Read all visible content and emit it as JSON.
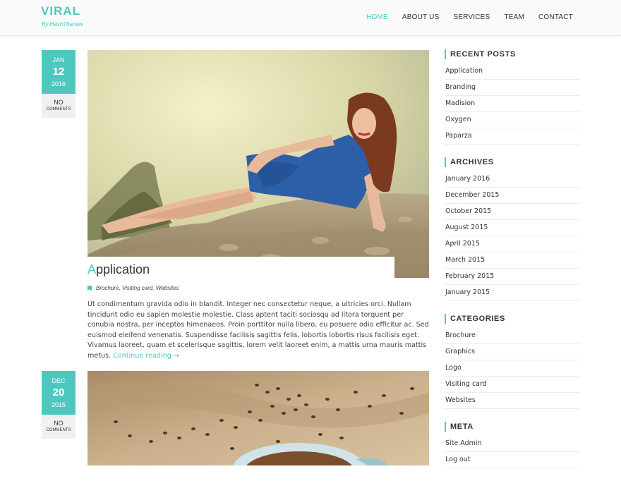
{
  "site": {
    "title": "VIRAL",
    "tagline": "By HashThemes"
  },
  "nav": {
    "items": [
      {
        "label": "HOME",
        "active": true
      },
      {
        "label": "ABOUT US"
      },
      {
        "label": "SERVICES"
      },
      {
        "label": "TEAM"
      },
      {
        "label": "CONTACT"
      }
    ]
  },
  "posts": [
    {
      "month": "JAN",
      "day": "12",
      "year": "2016",
      "comments_no": "NO",
      "comments_label": "COMMENTS",
      "title_first": "A",
      "title_rest": "pplication",
      "meta": "Brochure, Visiting card, Websites",
      "excerpt": "Ut condimentum gravida odio in blandit. Integer nec consectetur neque, a ultricies orci. Nullam tincidunt odio eu sapien molestie molestie. Class aptent taciti sociosqu ad litora torquent per conubia nostra, per inceptos himenaeos. Proin porttitor nulla libero, eu posuere odio efficitur ac. Sed euismod eleifend venenatis. Suspendisse facilisis sagittis felis, lobortis lobortis risus facilisis eget. Vivamus laoreet, quam et scelerisque sagittis, lorem velit laoreet enim, a mattis urna mauris mattis metus.",
      "read_more": "Continue reading →"
    },
    {
      "month": "DEC",
      "day": "20",
      "year": "2015",
      "comments_no": "NO",
      "comments_label": "COMMENTS"
    }
  ],
  "sidebar": {
    "recent_posts": {
      "title": "RECENT POSTS",
      "items": [
        "Application",
        "Branding",
        "Madision",
        "Oxygen",
        "Paparza"
      ]
    },
    "archives": {
      "title": "ARCHIVES",
      "items": [
        "January 2016",
        "December 2015",
        "October 2015",
        "August 2015",
        "April 2015",
        "March 2015",
        "February 2015",
        "January 2015"
      ]
    },
    "categories": {
      "title": "CATEGORIES",
      "items": [
        "Brochure",
        "Graphics",
        "Logo",
        "Visiting card",
        "Websites"
      ]
    },
    "meta": {
      "title": "META",
      "items": [
        "Site Admin",
        "Log out"
      ]
    }
  },
  "colors": {
    "accent": "#4ec8be",
    "text": "#444444",
    "header_bg": "#fafafa"
  }
}
